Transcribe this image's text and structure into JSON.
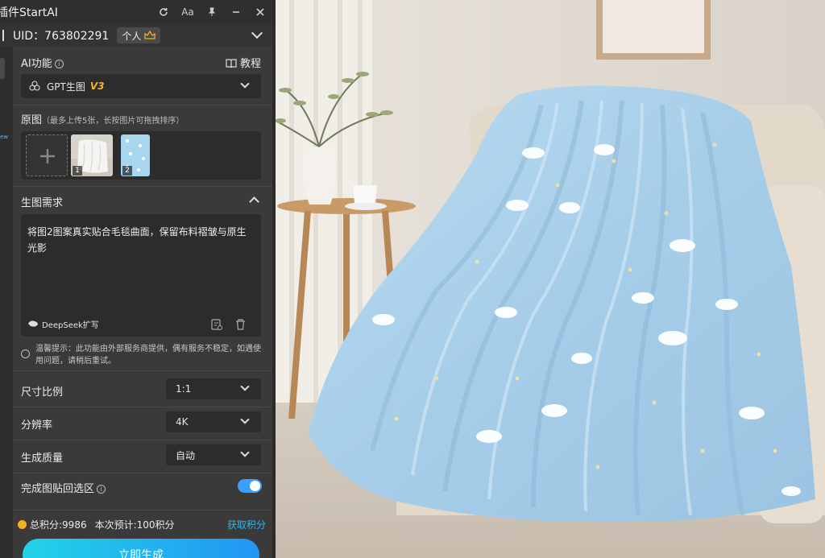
{
  "window": {
    "title": "插件StartAI",
    "buttons": {
      "refresh_icon": "refresh-icon",
      "font_label": "Aa",
      "pin_icon": "pin-icon",
      "minimize_icon": "minimize-icon",
      "close_icon": "close-icon"
    }
  },
  "account": {
    "uid": "UID：763802291",
    "badge_label": "个人"
  },
  "sidebar": {
    "new_tag": "ew"
  },
  "ai_function": {
    "label": "AI功能",
    "tutorial_label": "教程",
    "selected_model": "GPT生图",
    "model_version": "V3"
  },
  "source_images": {
    "label": "原图",
    "hint": "（最多上传5张，长按图片可拖拽排序）",
    "items": [
      {
        "index": "1"
      },
      {
        "index": "2"
      }
    ]
  },
  "prompt": {
    "label": "生图需求",
    "text": "将图2图案真实贴合毛毯曲面，保留布料褶皱与原生光影",
    "expand_button": "DeepSeek扩写"
  },
  "notice": "温馨提示：此功能由外部服务商提供，偶有服务不稳定，如遇使用问题，请稍后重试。",
  "settings": {
    "aspect_ratio": {
      "label": "尺寸比例",
      "value": "1:1"
    },
    "resolution": {
      "label": "分辨率",
      "value": "4K"
    },
    "quality": {
      "label": "生成质量",
      "value": "自动"
    },
    "paste_back": {
      "label": "完成图贴回选区",
      "enabled": true
    }
  },
  "footer": {
    "total_credits": "总积分:9986",
    "estimate": "本次预计:100积分",
    "get_credits": "获取积分",
    "generate_button": "立即生成"
  },
  "colors": {
    "accent": "#29b6f6",
    "panel_bg": "#3a3a3a",
    "coin": "#f2b21e",
    "blanket": "#a9cfe9"
  }
}
